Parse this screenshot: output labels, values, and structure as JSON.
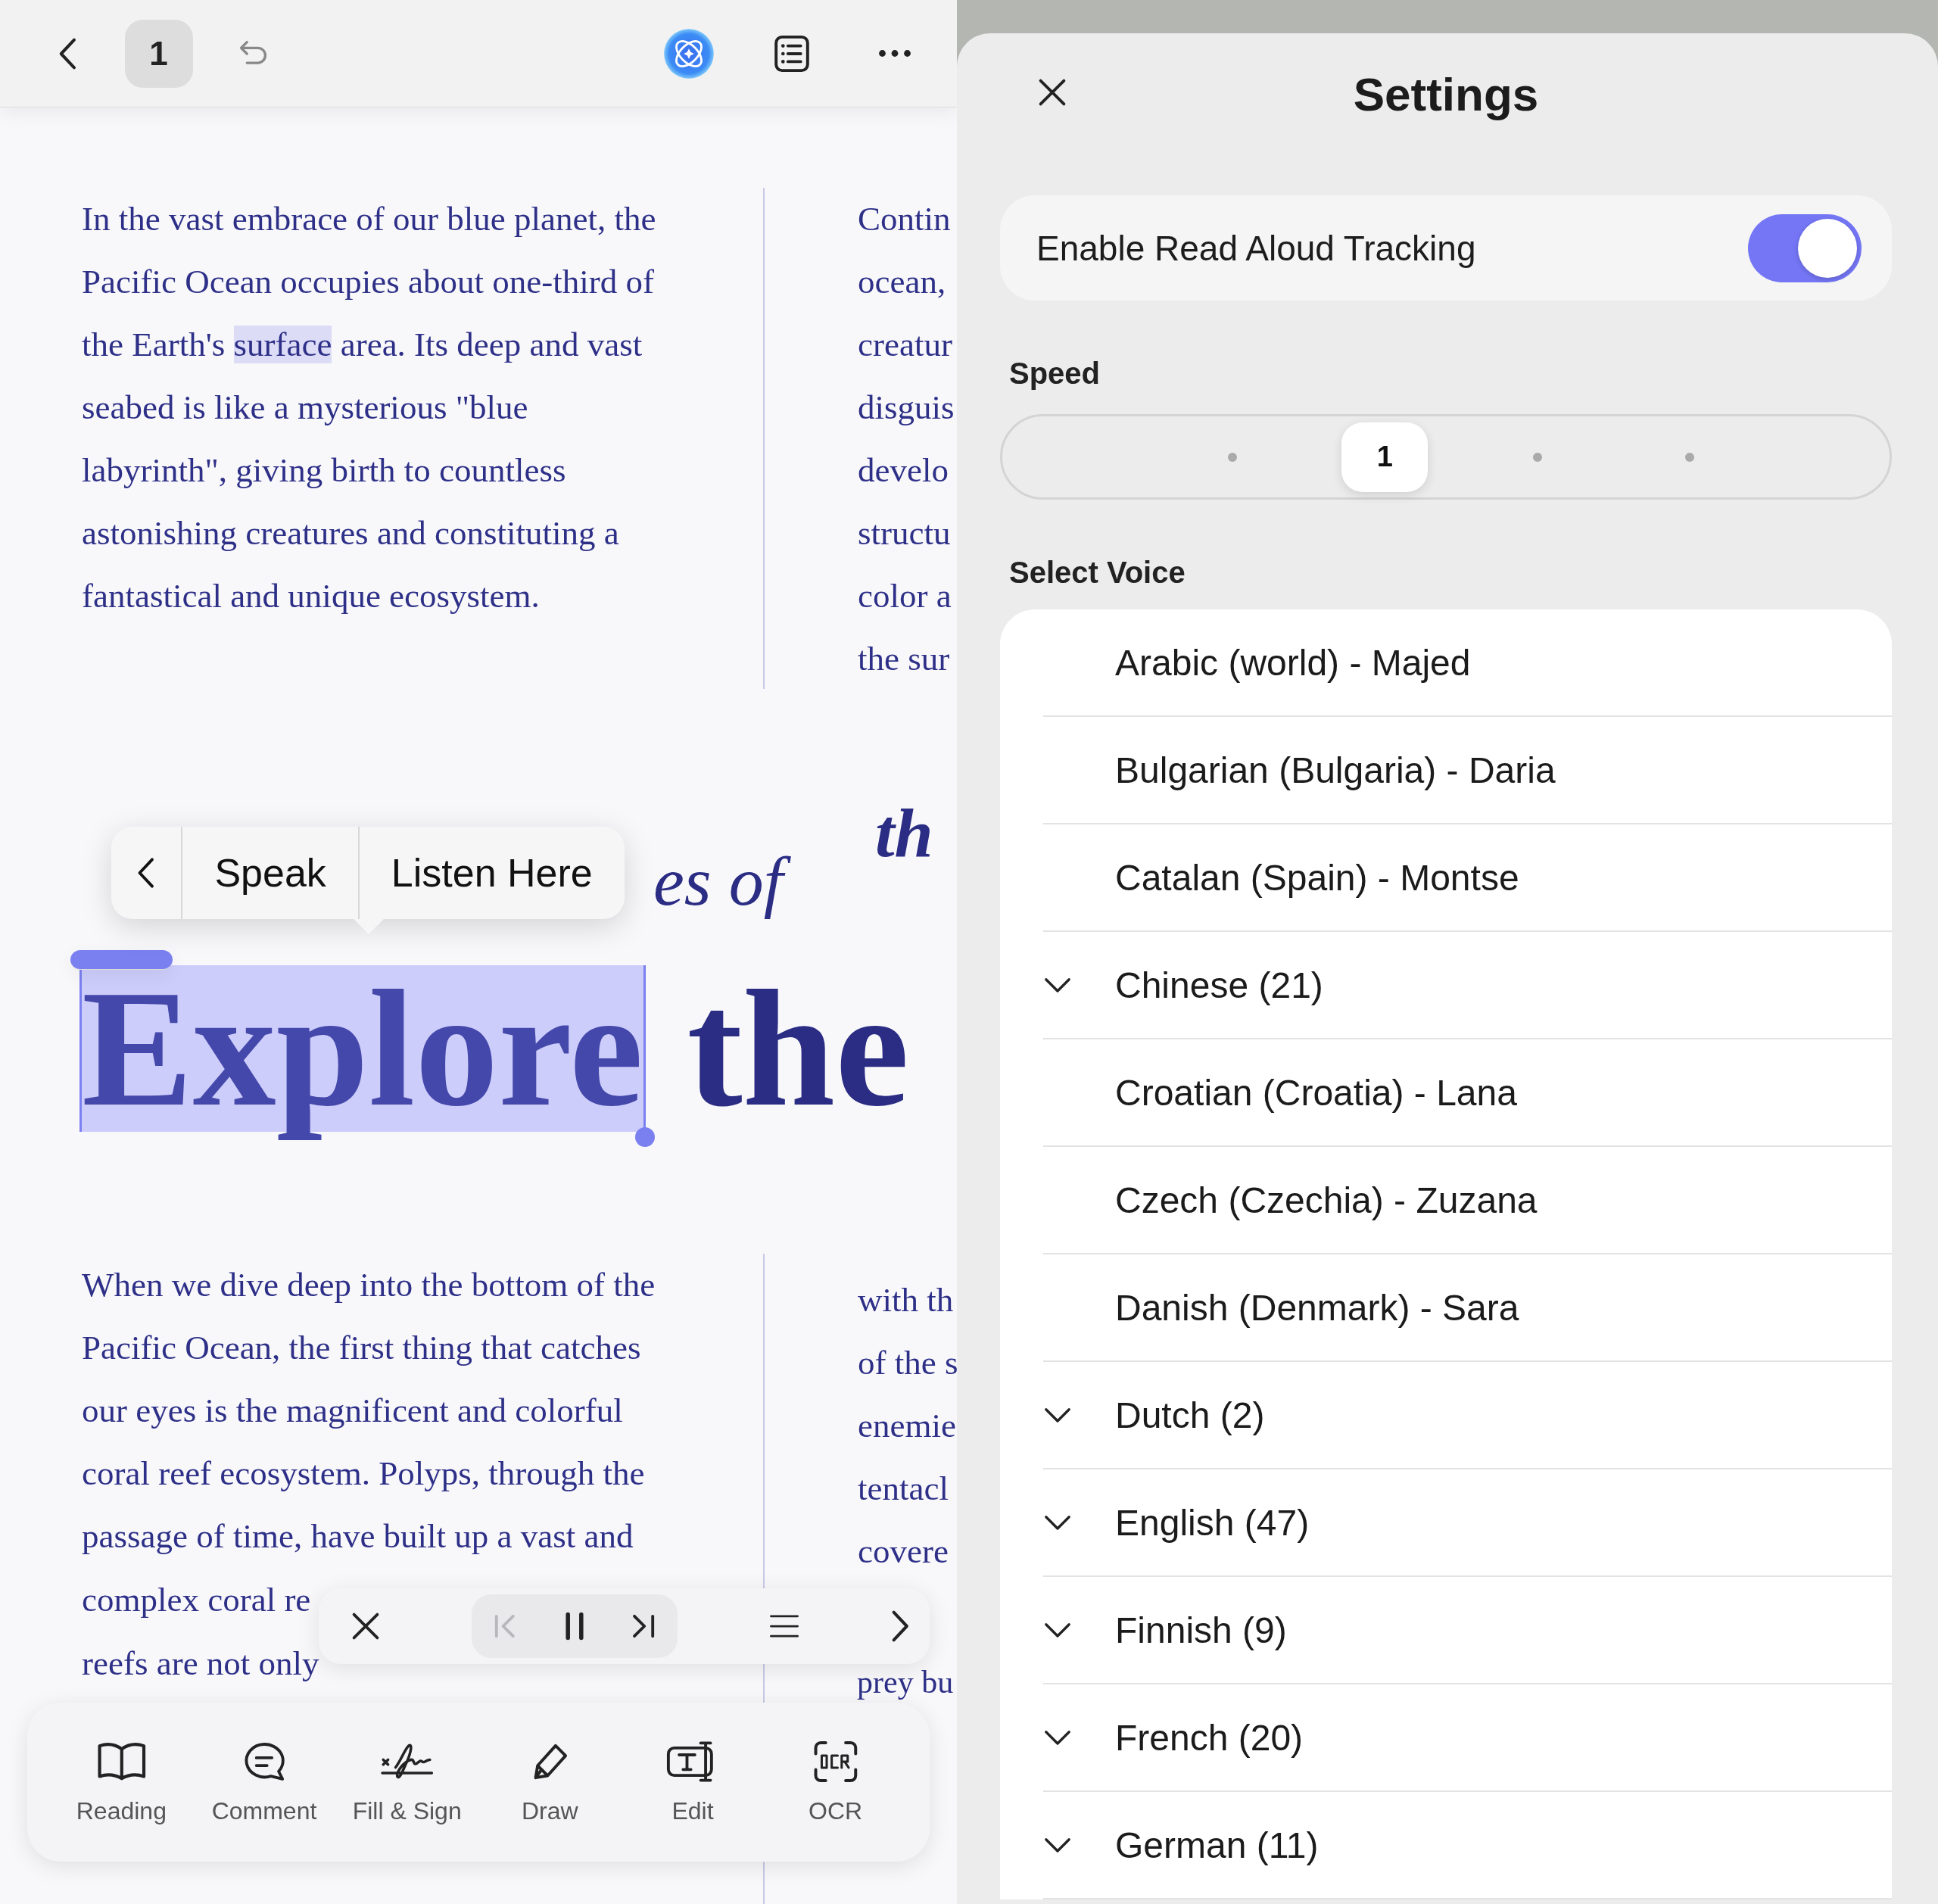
{
  "top_bar": {
    "page_number": "1"
  },
  "document": {
    "top_left_paragraph": {
      "parts": [
        {
          "text": "In the vast embrace of our blue planet, the Pacific Ocean occupies about one-third of the Earth's ",
          "highlighted": false
        },
        {
          "text": "surface",
          "highlighted": true
        },
        {
          "text": " area. Its deep and vast seabed is like a mysterious \"blue labyrinth\", giving birth to countless astonishing creatures and constituting a fantastical and unique ecosystem.",
          "highlighted": false
        }
      ]
    },
    "top_right_lines": [
      "Contin",
      "ocean,",
      "creatur",
      "disguis",
      "develo",
      "structu",
      "color a",
      "the sur"
    ],
    "subtitle_fragments": [
      "es of",
      "th"
    ],
    "heading": [
      {
        "text": "Explore",
        "selected": true
      },
      {
        "text": "the",
        "selected": false
      }
    ],
    "bottom_left_paragraph": "When we dive deep into the bottom of the Pacific Ocean, the first thing that catches our eyes is the magnificent and colorful coral reef ecosystem. Polyps, through the passage of time, have built up a vast and",
    "bottom_left_lines": [
      "complex coral re",
      "reefs are not only"
    ],
    "bottom_right_lines": [
      "with th",
      "of the s",
      "enemie",
      "tentacl",
      "covere"
    ],
    "bottom_right_tail": "prey bu"
  },
  "selection_menu": {
    "items": [
      {
        "kind": "back"
      },
      {
        "kind": "text",
        "label": "Speak"
      },
      {
        "kind": "text",
        "label": "Listen Here"
      }
    ]
  },
  "player": {
    "buttons": [
      {
        "kind": "close",
        "disabled": false
      },
      {
        "kind": "previous",
        "disabled": true
      },
      {
        "kind": "pause",
        "disabled": false
      },
      {
        "kind": "next",
        "disabled": false
      },
      {
        "kind": "list",
        "disabled": false
      },
      {
        "kind": "forward",
        "disabled": false
      }
    ]
  },
  "tools": [
    {
      "kind": "reading",
      "label": "Reading"
    },
    {
      "kind": "comment",
      "label": "Comment"
    },
    {
      "kind": "sign",
      "label": "Fill & Sign"
    },
    {
      "kind": "draw",
      "label": "Draw"
    },
    {
      "kind": "edit",
      "label": "Edit"
    },
    {
      "kind": "ocr",
      "label": "OCR"
    }
  ],
  "settings": {
    "title": "Settings",
    "read_aloud_tracking": {
      "label": "Enable Read Aloud Tracking",
      "on": true
    },
    "speed": {
      "label": "Speed",
      "stops": [
        {
          "selected": false
        },
        {
          "selected": true,
          "label": "1"
        },
        {
          "selected": false
        },
        {
          "selected": false
        }
      ]
    },
    "voice": {
      "label": "Select Voice",
      "items": [
        {
          "kind": "voice",
          "label": "Arabic (world) - Majed"
        },
        {
          "kind": "voice",
          "label": "Bulgarian (Bulgaria) - Daria"
        },
        {
          "kind": "voice",
          "label": "Catalan (Spain) - Montse"
        },
        {
          "kind": "group",
          "label": "Chinese (21)"
        },
        {
          "kind": "voice",
          "label": "Croatian (Croatia) - Lana"
        },
        {
          "kind": "voice",
          "label": "Czech (Czechia) - Zuzana"
        },
        {
          "kind": "voice",
          "label": "Danish (Denmark) - Sara"
        },
        {
          "kind": "group",
          "label": "Dutch (2)"
        },
        {
          "kind": "group",
          "label": "English (47)"
        },
        {
          "kind": "group",
          "label": "Finnish (9)"
        },
        {
          "kind": "group",
          "label": "French (20)"
        },
        {
          "kind": "group",
          "label": "German (11)"
        }
      ]
    }
  }
}
